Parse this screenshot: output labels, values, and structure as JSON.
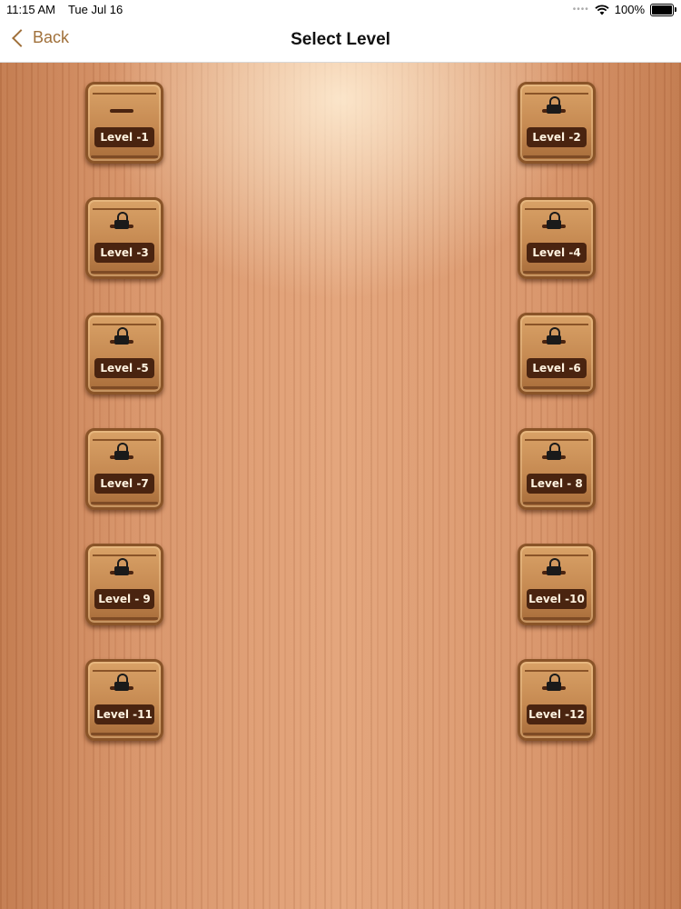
{
  "status": {
    "time": "11:15 AM",
    "date": "Tue Jul 16",
    "battery": "100%"
  },
  "nav": {
    "back_label": "Back",
    "title": "Select Level"
  },
  "levels": [
    {
      "label": "Level -1",
      "locked": false
    },
    {
      "label": "Level -2",
      "locked": true
    },
    {
      "label": "Level -3",
      "locked": true
    },
    {
      "label": "Level -4",
      "locked": true
    },
    {
      "label": "Level -5",
      "locked": true
    },
    {
      "label": "Level -6",
      "locked": true
    },
    {
      "label": "Level -7",
      "locked": true
    },
    {
      "label": "Level - 8",
      "locked": true
    },
    {
      "label": "Level - 9",
      "locked": true
    },
    {
      "label": "Level -10",
      "locked": true
    },
    {
      "label": "Level -11",
      "locked": true
    },
    {
      "label": "Level -12",
      "locked": true
    }
  ]
}
